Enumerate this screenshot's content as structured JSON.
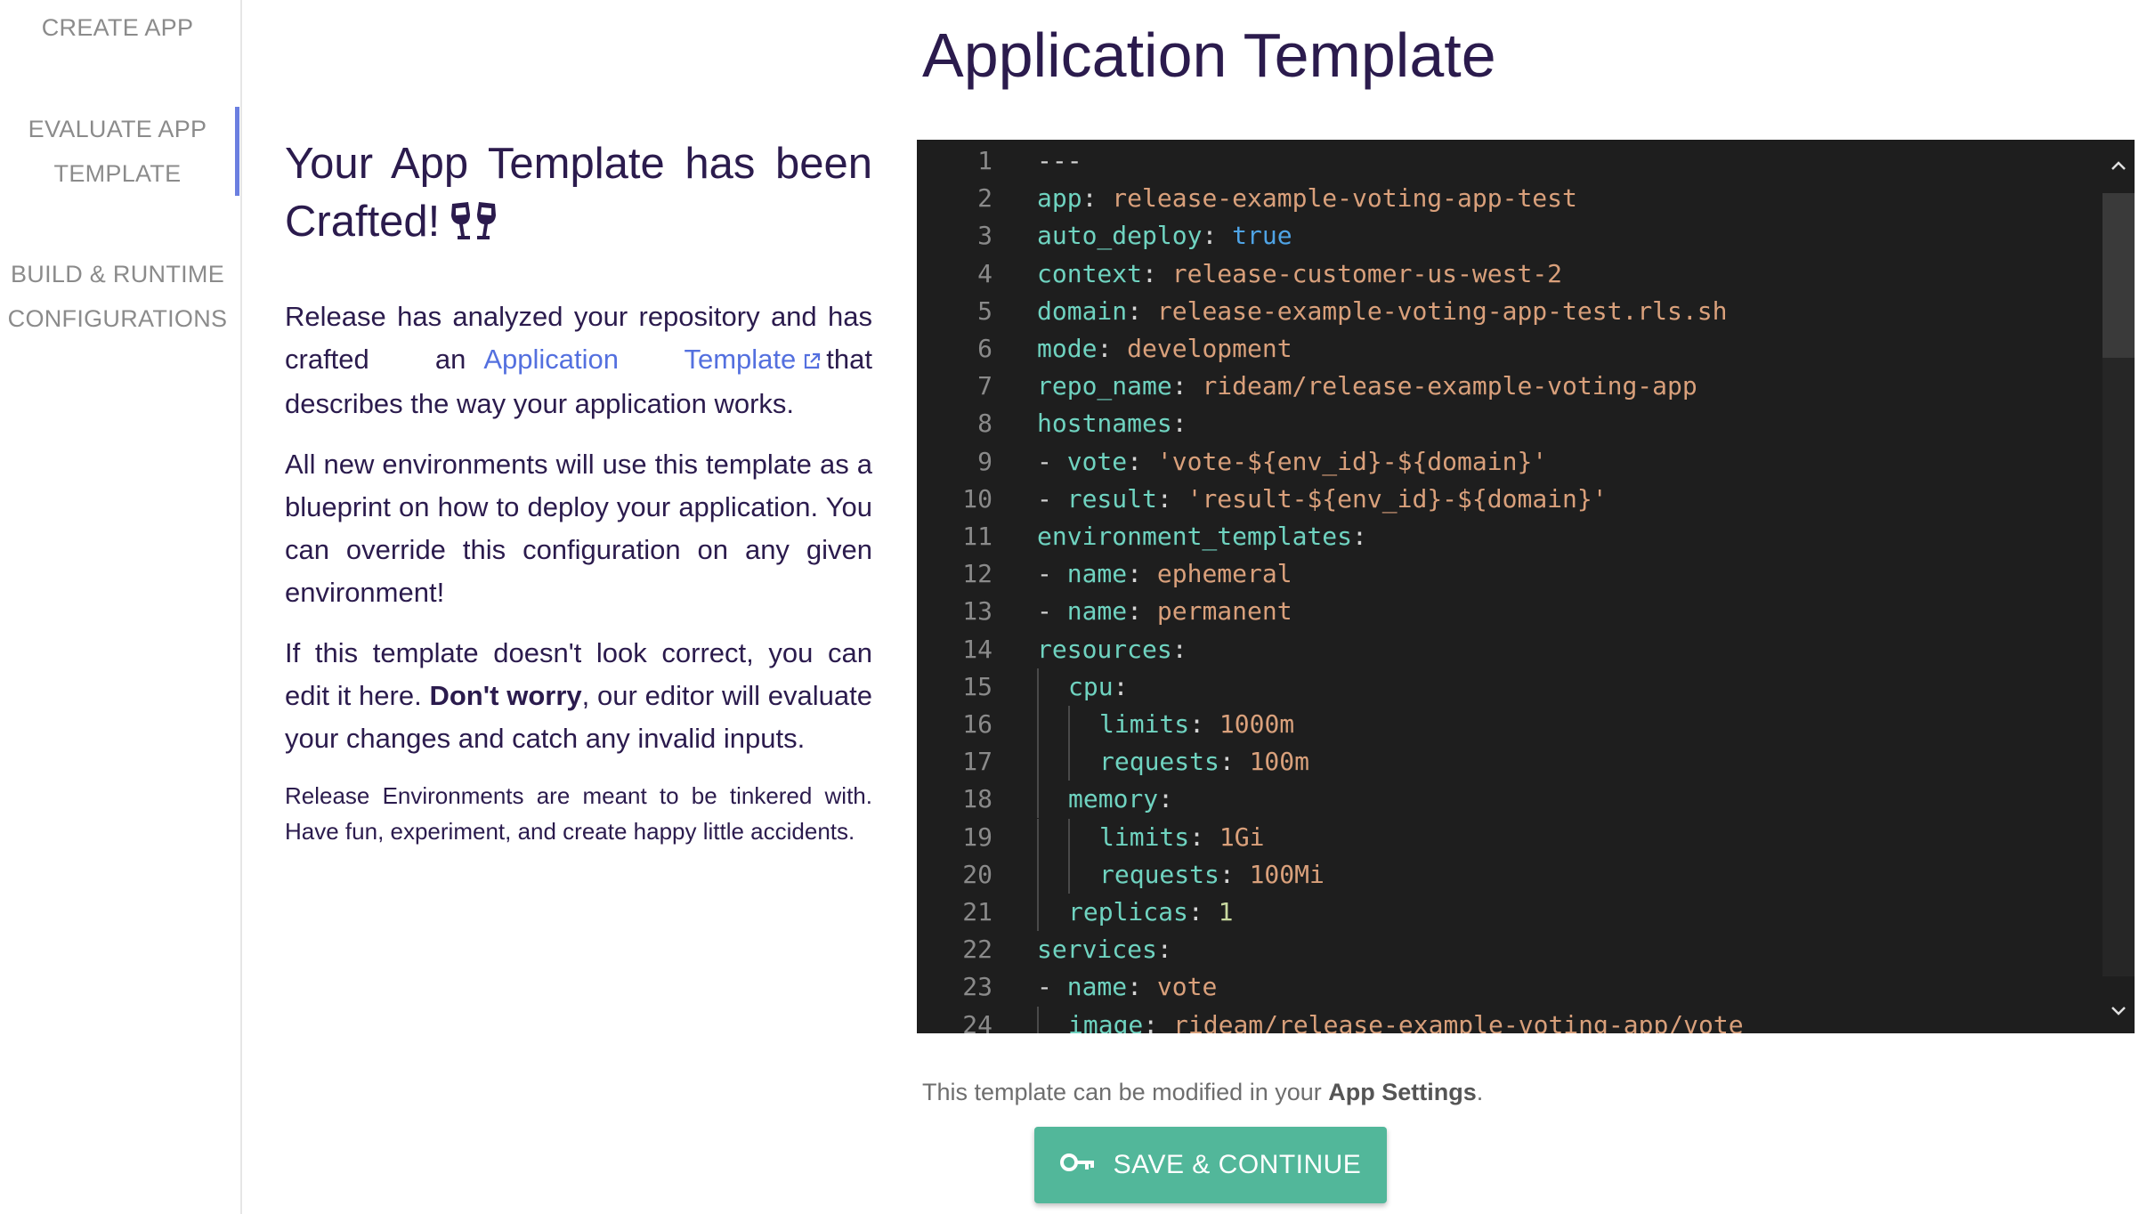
{
  "sidebar": {
    "steps": [
      {
        "line1": "CREATE APP",
        "line2": ""
      },
      {
        "line1": "EVALUATE APP",
        "line2": "TEMPLATE"
      },
      {
        "line1": "BUILD & RUNTIME",
        "line2": "CONFIGURATIONS"
      }
    ],
    "active_step": 1
  },
  "page_title": "Application Template",
  "intro": {
    "heading": "Your App Template has been Crafted!",
    "p1_before": "Release has analyzed your repository and has crafted an",
    "p1_link": "Application Template",
    "p1_after": "that describes the way your application works.",
    "p2": "All new environments will use this template as a blueprint on how to deploy your application. You can override this configuration on any given environment!",
    "p3_before": "If this template doesn't look correct, you can edit it here.",
    "p3_bold": "Don't worry",
    "p3_after": ", our editor will evaluate your changes and catch any invalid inputs.",
    "p4": "Release Environments are meant to be tinkered with. Have fun, experiment, and create happy little accidents."
  },
  "editor": {
    "lines": [
      {
        "n": "1",
        "indent": 0,
        "parts": [
          [
            "p",
            "---"
          ]
        ]
      },
      {
        "n": "2",
        "indent": 0,
        "parts": [
          [
            "k",
            "app"
          ],
          [
            "p",
            ": "
          ],
          [
            "s",
            "release-example-voting-app-test"
          ]
        ]
      },
      {
        "n": "3",
        "indent": 0,
        "parts": [
          [
            "k",
            "auto_deploy"
          ],
          [
            "p",
            ": "
          ],
          [
            "b",
            "true"
          ]
        ]
      },
      {
        "n": "4",
        "indent": 0,
        "parts": [
          [
            "k",
            "context"
          ],
          [
            "p",
            ": "
          ],
          [
            "s",
            "release-customer-us-west-2"
          ]
        ]
      },
      {
        "n": "5",
        "indent": 0,
        "parts": [
          [
            "k",
            "domain"
          ],
          [
            "p",
            ": "
          ],
          [
            "s",
            "release-example-voting-app-test.rls.sh"
          ]
        ]
      },
      {
        "n": "6",
        "indent": 0,
        "parts": [
          [
            "k",
            "mode"
          ],
          [
            "p",
            ": "
          ],
          [
            "s",
            "development"
          ]
        ]
      },
      {
        "n": "7",
        "indent": 0,
        "parts": [
          [
            "k",
            "repo_name"
          ],
          [
            "p",
            ": "
          ],
          [
            "s",
            "rideam/release-example-voting-app"
          ]
        ]
      },
      {
        "n": "8",
        "indent": 0,
        "parts": [
          [
            "k",
            "hostnames"
          ],
          [
            "p",
            ":"
          ]
        ]
      },
      {
        "n": "9",
        "indent": 0,
        "parts": [
          [
            "p",
            "- "
          ],
          [
            "k",
            "vote"
          ],
          [
            "p",
            ": "
          ],
          [
            "s",
            "'vote-${env_id}-${domain}'"
          ]
        ]
      },
      {
        "n": "10",
        "indent": 0,
        "parts": [
          [
            "p",
            "- "
          ],
          [
            "k",
            "result"
          ],
          [
            "p",
            ": "
          ],
          [
            "s",
            "'result-${env_id}-${domain}'"
          ]
        ]
      },
      {
        "n": "11",
        "indent": 0,
        "parts": [
          [
            "k",
            "environment_templates"
          ],
          [
            "p",
            ":"
          ]
        ]
      },
      {
        "n": "12",
        "indent": 0,
        "parts": [
          [
            "p",
            "- "
          ],
          [
            "k",
            "name"
          ],
          [
            "p",
            ": "
          ],
          [
            "s",
            "ephemeral"
          ]
        ]
      },
      {
        "n": "13",
        "indent": 0,
        "parts": [
          [
            "p",
            "- "
          ],
          [
            "k",
            "name"
          ],
          [
            "p",
            ": "
          ],
          [
            "s",
            "permanent"
          ]
        ]
      },
      {
        "n": "14",
        "indent": 0,
        "parts": [
          [
            "k",
            "resources"
          ],
          [
            "p",
            ":"
          ]
        ]
      },
      {
        "n": "15",
        "indent": 1,
        "parts": [
          [
            "k",
            "cpu"
          ],
          [
            "p",
            ":"
          ]
        ]
      },
      {
        "n": "16",
        "indent": 2,
        "parts": [
          [
            "k",
            "limits"
          ],
          [
            "p",
            ": "
          ],
          [
            "s",
            "1000m"
          ]
        ]
      },
      {
        "n": "17",
        "indent": 2,
        "parts": [
          [
            "k",
            "requests"
          ],
          [
            "p",
            ": "
          ],
          [
            "s",
            "100m"
          ]
        ]
      },
      {
        "n": "18",
        "indent": 1,
        "parts": [
          [
            "k",
            "memory"
          ],
          [
            "p",
            ":"
          ]
        ]
      },
      {
        "n": "19",
        "indent": 2,
        "parts": [
          [
            "k",
            "limits"
          ],
          [
            "p",
            ": "
          ],
          [
            "s",
            "1Gi"
          ]
        ]
      },
      {
        "n": "20",
        "indent": 2,
        "parts": [
          [
            "k",
            "requests"
          ],
          [
            "p",
            ": "
          ],
          [
            "s",
            "100Mi"
          ]
        ]
      },
      {
        "n": "21",
        "indent": 1,
        "parts": [
          [
            "k",
            "replicas"
          ],
          [
            "p",
            ": "
          ],
          [
            "n",
            "1"
          ]
        ]
      },
      {
        "n": "22",
        "indent": 0,
        "parts": [
          [
            "k",
            "services"
          ],
          [
            "p",
            ":"
          ]
        ]
      },
      {
        "n": "23",
        "indent": 0,
        "parts": [
          [
            "p",
            "- "
          ],
          [
            "k",
            "name"
          ],
          [
            "p",
            ": "
          ],
          [
            "s",
            "vote"
          ]
        ]
      },
      {
        "n": "24",
        "indent": 1,
        "parts": [
          [
            "k",
            "image"
          ],
          [
            "p",
            ": "
          ],
          [
            "s",
            "rideam/release-example-voting-app/vote"
          ]
        ]
      }
    ]
  },
  "footer": {
    "note_before": "This template can be modified in your",
    "note_bold": "App Settings",
    "note_after": ".",
    "save_label": "SAVE & CONTINUE"
  },
  "colors": {
    "accent": "#6b7fe0",
    "link": "#5470df",
    "button": "#52b79a",
    "heading": "#2b1b4d",
    "editor_bg": "#1e1e1e"
  },
  "icons": {
    "heading_icon": "clinking-glasses-icon",
    "link_icon": "external-link-icon",
    "button_icon": "key-icon",
    "scroll_up": "chevron-up-icon",
    "scroll_down": "chevron-down-icon"
  }
}
